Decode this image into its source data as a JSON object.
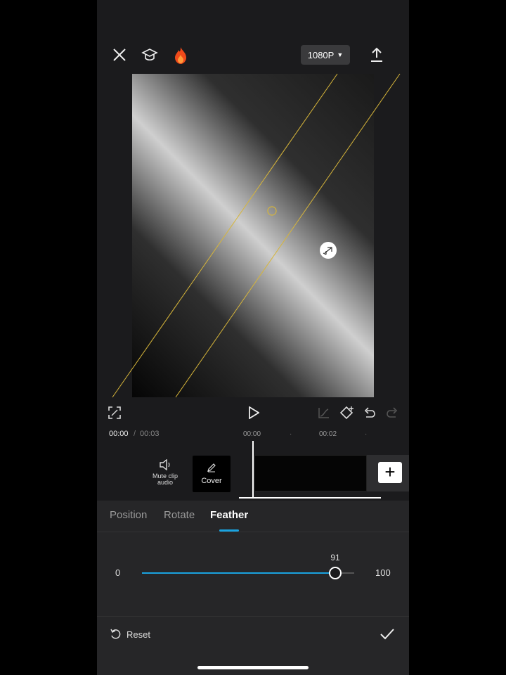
{
  "topbar": {
    "close_icon": "close-icon",
    "tutorial_icon": "graduation-cap-icon",
    "trending_icon": "flame-icon",
    "resolution_label": "1080P",
    "export_icon": "upload-icon"
  },
  "preview": {
    "mask_type": "linear-band",
    "center_handle_icon": "circle-handle-icon",
    "feather_handle_icon": "feather-arrows-icon"
  },
  "controls": {
    "fullscreen_icon": "fullscreen-icon",
    "play_icon": "play-icon",
    "keyframe_curve_icon": "curve-icon",
    "keyframe_icon": "keyframe-diamond-icon",
    "undo_icon": "undo-icon",
    "redo_icon": "redo-icon"
  },
  "timeline": {
    "current_time": "00:00",
    "separator": "/",
    "total_time": "00:03",
    "ruler_marks": [
      "00:00",
      "00:02"
    ]
  },
  "tools": {
    "mute_label": "Mute clip audio",
    "cover_label": "Cover",
    "add_label": "+"
  },
  "panel": {
    "tabs": [
      {
        "label": "Position",
        "active": false
      },
      {
        "label": "Rotate",
        "active": false
      },
      {
        "label": "Feather",
        "active": true
      }
    ],
    "slider": {
      "min_label": "0",
      "max_label": "100",
      "value": 91,
      "value_label": "91"
    },
    "reset_label": "Reset",
    "confirm_icon": "checkmark-icon"
  },
  "colors": {
    "accent": "#1aa3e0",
    "mask_line": "#d6b53a",
    "flame": "#f04a1a"
  }
}
